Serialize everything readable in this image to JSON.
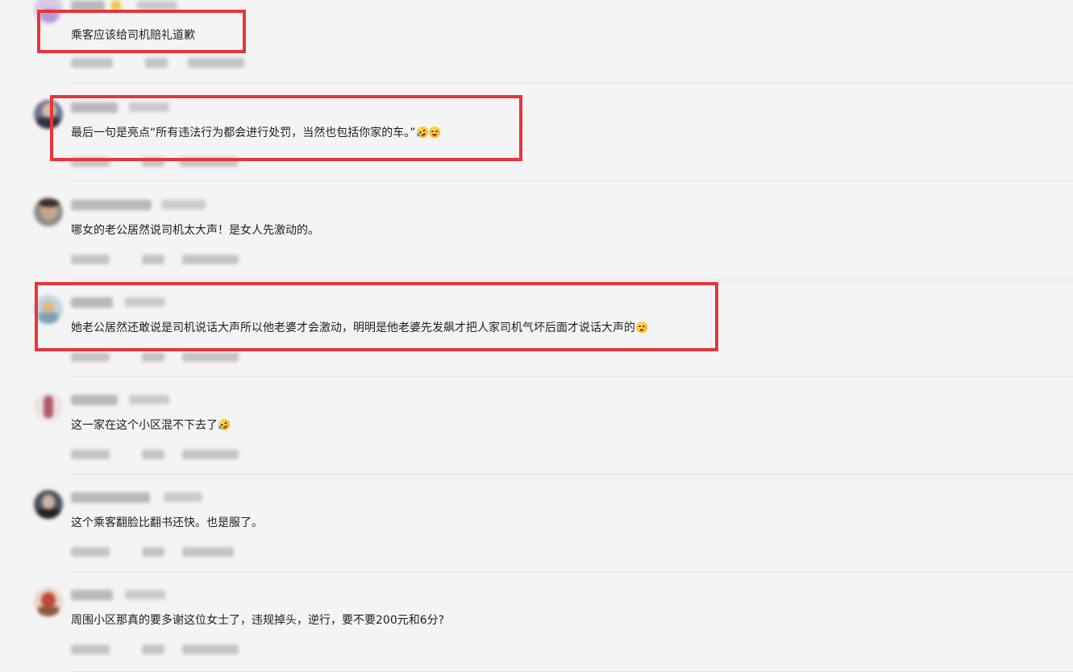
{
  "comments": [
    {
      "text": "乘客应该给司机赔礼道歉",
      "emoji": []
    },
    {
      "text": "最后一句是亮点“所有违法行为都会进行处罚，当然也包括你家的车。”",
      "emoji": [
        "laugh-tears-emoji",
        "grin-emoji"
      ]
    },
    {
      "text": "哪女的老公居然说司机太大声！是女人先激动的。",
      "emoji": []
    },
    {
      "text": "她老公居然还敢说是司机说话大声所以他老婆才会激动，明明是他老婆先发飙才把人家司机气坏后面才说话大声的",
      "emoji": [
        "thinking-emoji"
      ]
    },
    {
      "text": "这一家在这个小区混不下去了",
      "emoji": [
        "laugh-tears-emoji"
      ]
    },
    {
      "text": "这个乘客翻脸比翻书还快。也是服了。",
      "emoji": []
    },
    {
      "text": "周围小区那真的要多谢这位女士了，违规掉头，逆行，要不要200元和6分?",
      "emoji": []
    }
  ],
  "colors": {
    "background": "#f4f4f4",
    "highlight": "#e8343b",
    "divider": "#e2e2e2",
    "text": "#1f1f1f"
  }
}
